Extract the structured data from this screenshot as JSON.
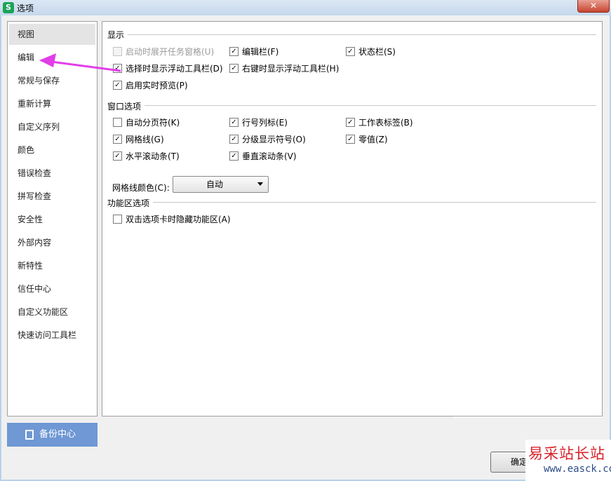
{
  "window": {
    "app_icon_letter": "S",
    "title": "选项",
    "close_symbol": "✕"
  },
  "sidebar": {
    "items": [
      {
        "label": "视图",
        "selected": true
      },
      {
        "label": "编辑",
        "selected": false
      },
      {
        "label": "常规与保存",
        "selected": false
      },
      {
        "label": "重新计算",
        "selected": false
      },
      {
        "label": "自定义序列",
        "selected": false
      },
      {
        "label": "颜色",
        "selected": false
      },
      {
        "label": "错误检查",
        "selected": false
      },
      {
        "label": "拼写检查",
        "selected": false
      },
      {
        "label": "安全性",
        "selected": false
      },
      {
        "label": "外部内容",
        "selected": false
      },
      {
        "label": "新特性",
        "selected": false
      },
      {
        "label": "信任中心",
        "selected": false
      },
      {
        "label": "自定义功能区",
        "selected": false
      },
      {
        "label": "快速访问工具栏",
        "selected": false
      }
    ],
    "backup_label": "备份中心",
    "backup_icon": "document-copy-icon"
  },
  "display": {
    "title": "显示",
    "options": [
      {
        "label": "启动时展开任务窗格(U)",
        "checked": false,
        "disabled": true
      },
      {
        "label": "编辑栏(F)",
        "checked": true,
        "disabled": false
      },
      {
        "label": "状态栏(S)",
        "checked": true,
        "disabled": false
      },
      {
        "label": "选择时显示浮动工具栏(D)",
        "checked": true,
        "disabled": false
      },
      {
        "label": "右键时显示浮动工具栏(H)",
        "checked": true,
        "disabled": false
      },
      {
        "label": "启用实时预览(P)",
        "checked": true,
        "disabled": false
      }
    ]
  },
  "window_options": {
    "title": "窗口选项",
    "options": [
      {
        "label": "自动分页符(K)",
        "checked": false
      },
      {
        "label": "行号列标(E)",
        "checked": true
      },
      {
        "label": "工作表标签(B)",
        "checked": true
      },
      {
        "label": "网格线(G)",
        "checked": true
      },
      {
        "label": "分级显示符号(O)",
        "checked": true
      },
      {
        "label": "零值(Z)",
        "checked": true
      },
      {
        "label": "水平滚动条(T)",
        "checked": true
      },
      {
        "label": "垂直滚动条(V)",
        "checked": true
      }
    ],
    "gridline_color_label": "网格线颜色(C):",
    "gridline_color_value": "自动"
  },
  "ribbon_options": {
    "title": "功能区选项",
    "options": [
      {
        "label": "双击选项卡时隐藏功能区(A)",
        "checked": false
      }
    ]
  },
  "footer": {
    "ok_label": "确定"
  },
  "watermark": {
    "text": "易采站长站",
    "url": "www.easck.com"
  },
  "colors": {
    "annotation_arrow": "#e23ee8",
    "backup_button_bg": "#6f98d4",
    "selected_item_bg": "#e4e4e4"
  }
}
